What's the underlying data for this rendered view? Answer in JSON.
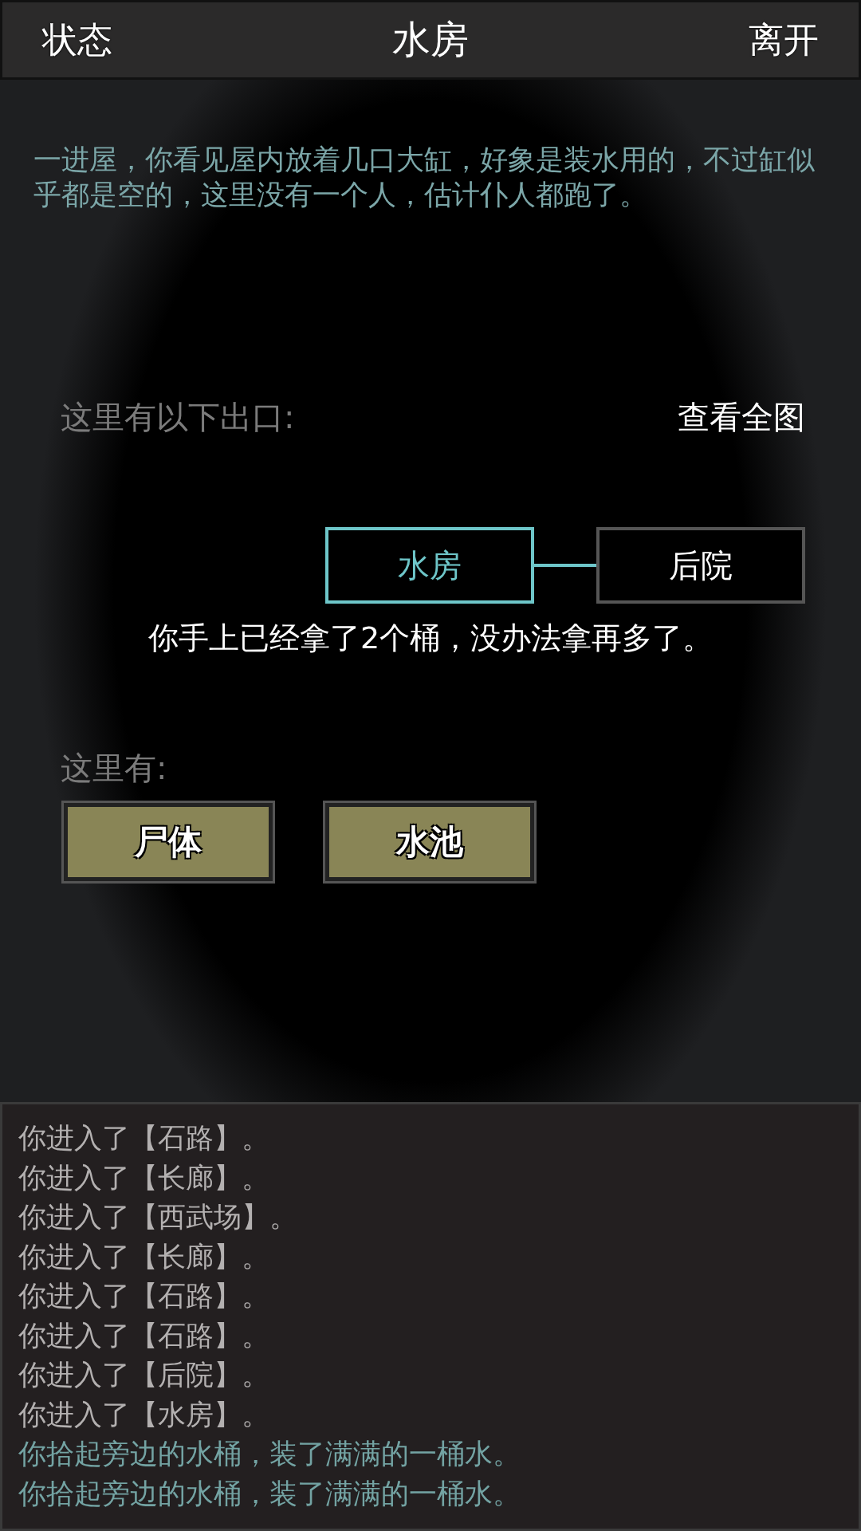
{
  "header": {
    "left_button": "状态",
    "title": "水房",
    "right_button": "离开"
  },
  "description": "一进屋，你看见屋内放着几口大缸，好象是装水用的，不过缸似乎都是空的，这里没有一个人，估计仆人都跑了。",
  "exits": {
    "label": "这里有以下出口:",
    "map_link": "查看全图",
    "nodes": [
      {
        "label": "水房",
        "selected": true
      },
      {
        "label": "后院",
        "selected": false
      }
    ]
  },
  "message": "你手上已经拿了2个桶，没办法拿再多了。",
  "objects": {
    "label": "这里有:",
    "items": [
      "尸体",
      "水池"
    ]
  },
  "log": [
    {
      "kind": "move",
      "text": "你进入了【石路】。"
    },
    {
      "kind": "move",
      "text": "你进入了【长廊】。"
    },
    {
      "kind": "move",
      "text": "你进入了【西武场】。"
    },
    {
      "kind": "move",
      "text": "你进入了【长廊】。"
    },
    {
      "kind": "move",
      "text": "你进入了【石路】。"
    },
    {
      "kind": "move",
      "text": "你进入了【石路】。"
    },
    {
      "kind": "move",
      "text": "你进入了【后院】。"
    },
    {
      "kind": "move",
      "text": "你进入了【水房】。"
    },
    {
      "kind": "action",
      "text": "你拾起旁边的水桶，装了满满的一桶水。"
    },
    {
      "kind": "action",
      "text": "你拾起旁边的水桶，装了满满的一桶水。"
    }
  ]
}
